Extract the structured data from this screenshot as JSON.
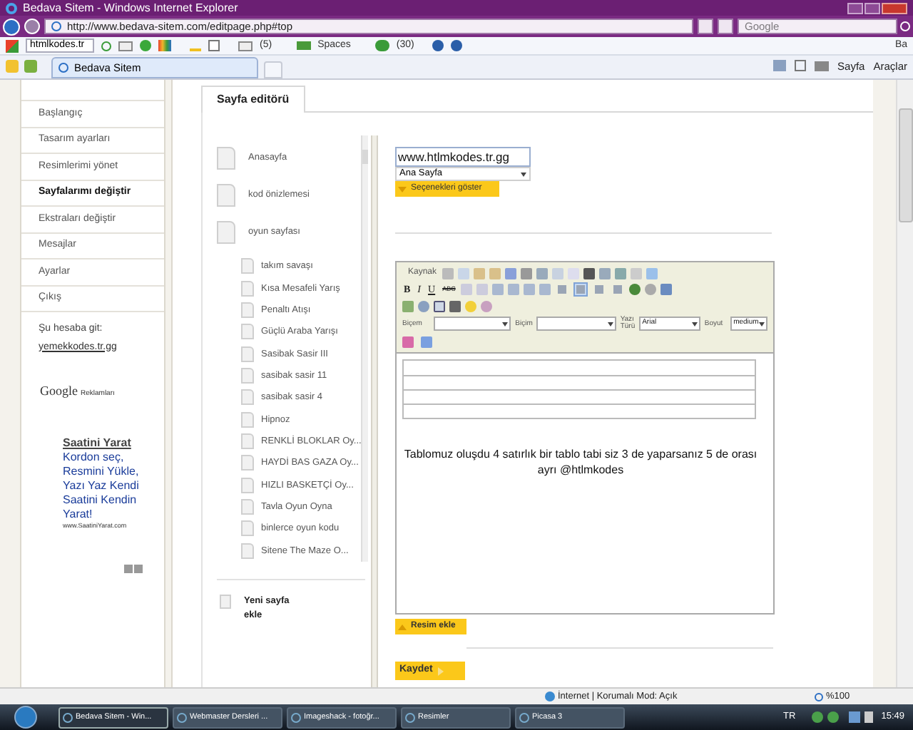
{
  "window": {
    "title": "Bedava Sitem - Windows Internet Explorer"
  },
  "address_bar": {
    "url": "http://www.bedava-sitem.com/editpage.php#top"
  },
  "search": {
    "placeholder": "Google"
  },
  "links_toolbar": {
    "search_value": "htmlkodes.tr",
    "mail_count": "(5)",
    "spaces": "Spaces",
    "messenger_count": "(30)",
    "cut_label": "Ba"
  },
  "tabs": [
    {
      "label": "Bedava Sitem",
      "selected": true
    }
  ],
  "command_bar": {
    "page": "Sayfa",
    "tools": "Araçlar"
  },
  "sidebar": {
    "items": [
      {
        "label": "Başlangıç",
        "selected": false
      },
      {
        "label": "Tasarım ayarları",
        "selected": false
      },
      {
        "label": "Resimlerimi yönet",
        "selected": false
      },
      {
        "label": "Sayfalarımı değiştir",
        "selected": true
      },
      {
        "label": "Ekstraları değiştir",
        "selected": false
      },
      {
        "label": "Mesajlar",
        "selected": false
      },
      {
        "label": "Ayarlar",
        "selected": false
      },
      {
        "label": "Çıkış",
        "selected": false
      }
    ],
    "account_label": "Şu hesaba git:",
    "account_link": "yemekkodes.tr.gg",
    "ads_logo": "Google",
    "ads_label": "Reklamları",
    "ad": {
      "title": "Saatini Yarat",
      "lines": [
        "Kordon seç,",
        "Resmini Yükle,",
        "Yazı Yaz Kendi",
        "Saatini Kendin",
        "Yarat!"
      ],
      "url": "www.SaatiniYarat.com"
    }
  },
  "editor_tab": {
    "label": "Sayfa editörü"
  },
  "page_tree": [
    {
      "label": "Anasayfa"
    },
    {
      "label": "kod önizlemesi"
    },
    {
      "label": "oyun sayfası",
      "children": [
        {
          "label": "takım savaşı"
        },
        {
          "label": "Kısa Mesafeli Yarış"
        },
        {
          "label": "Penaltı Atışı"
        },
        {
          "label": "Güçlü Araba Yarışı"
        },
        {
          "label": "Sasibak Sasir III"
        },
        {
          "label": "sasibak sasir 11"
        },
        {
          "label": "sasibak sasir 4"
        },
        {
          "label": "Hipnoz"
        },
        {
          "label": "RENKLİ BLOKLAR Oy..."
        },
        {
          "label": "HAYDİ BAS GAZA Oy..."
        },
        {
          "label": "HIZLI BASKETÇİ Oy..."
        },
        {
          "label": "Tavla Oyun Oyna"
        },
        {
          "label": "binlerce oyun kodu"
        },
        {
          "label": "Sitene The Maze O..."
        }
      ]
    }
  ],
  "new_page": {
    "label": "Yeni sayfa ekle"
  },
  "page_form": {
    "url_value": "www.htlmkodes.tr.gg",
    "parent_select": "Ana Sayfa",
    "options_button": "Seçenekleri göster"
  },
  "editor": {
    "source_button": "Kaynak",
    "format_buttons": [
      "B",
      "I",
      "U",
      "ABC"
    ],
    "alignment": [
      {
        "selected": false
      },
      {
        "selected": true
      },
      {
        "selected": false
      },
      {
        "selected": false
      }
    ],
    "dropdowns": [
      {
        "label": "Biçem"
      },
      {
        "label": "Biçim"
      },
      {
        "label": "Yazı Türü",
        "value": "Arial"
      },
      {
        "label": "Boyut",
        "value": "medium"
      }
    ],
    "text": "Tablomuz oluşdu 4 satırlık bir tablo tabi siz 3 de yaparsanız 5 de orası ayrı @htlmkodes"
  },
  "image_button": "Resim ekle",
  "save_button": "Kaydet",
  "status_bar": {
    "zone": "İnternet | Korumalı Mod: Açık",
    "zoom": "%100"
  },
  "taskbar": {
    "items": [
      {
        "label": "Bedava Sitem - Win...",
        "selected": true
      },
      {
        "label": "Webmaster Dersleri ...",
        "selected": false
      },
      {
        "label": "Imageshack - fotoğr...",
        "selected": false
      },
      {
        "label": "Resimler",
        "selected": false
      },
      {
        "label": "Picasa 3",
        "selected": false
      }
    ],
    "language": "TR",
    "clock": "15:49"
  }
}
